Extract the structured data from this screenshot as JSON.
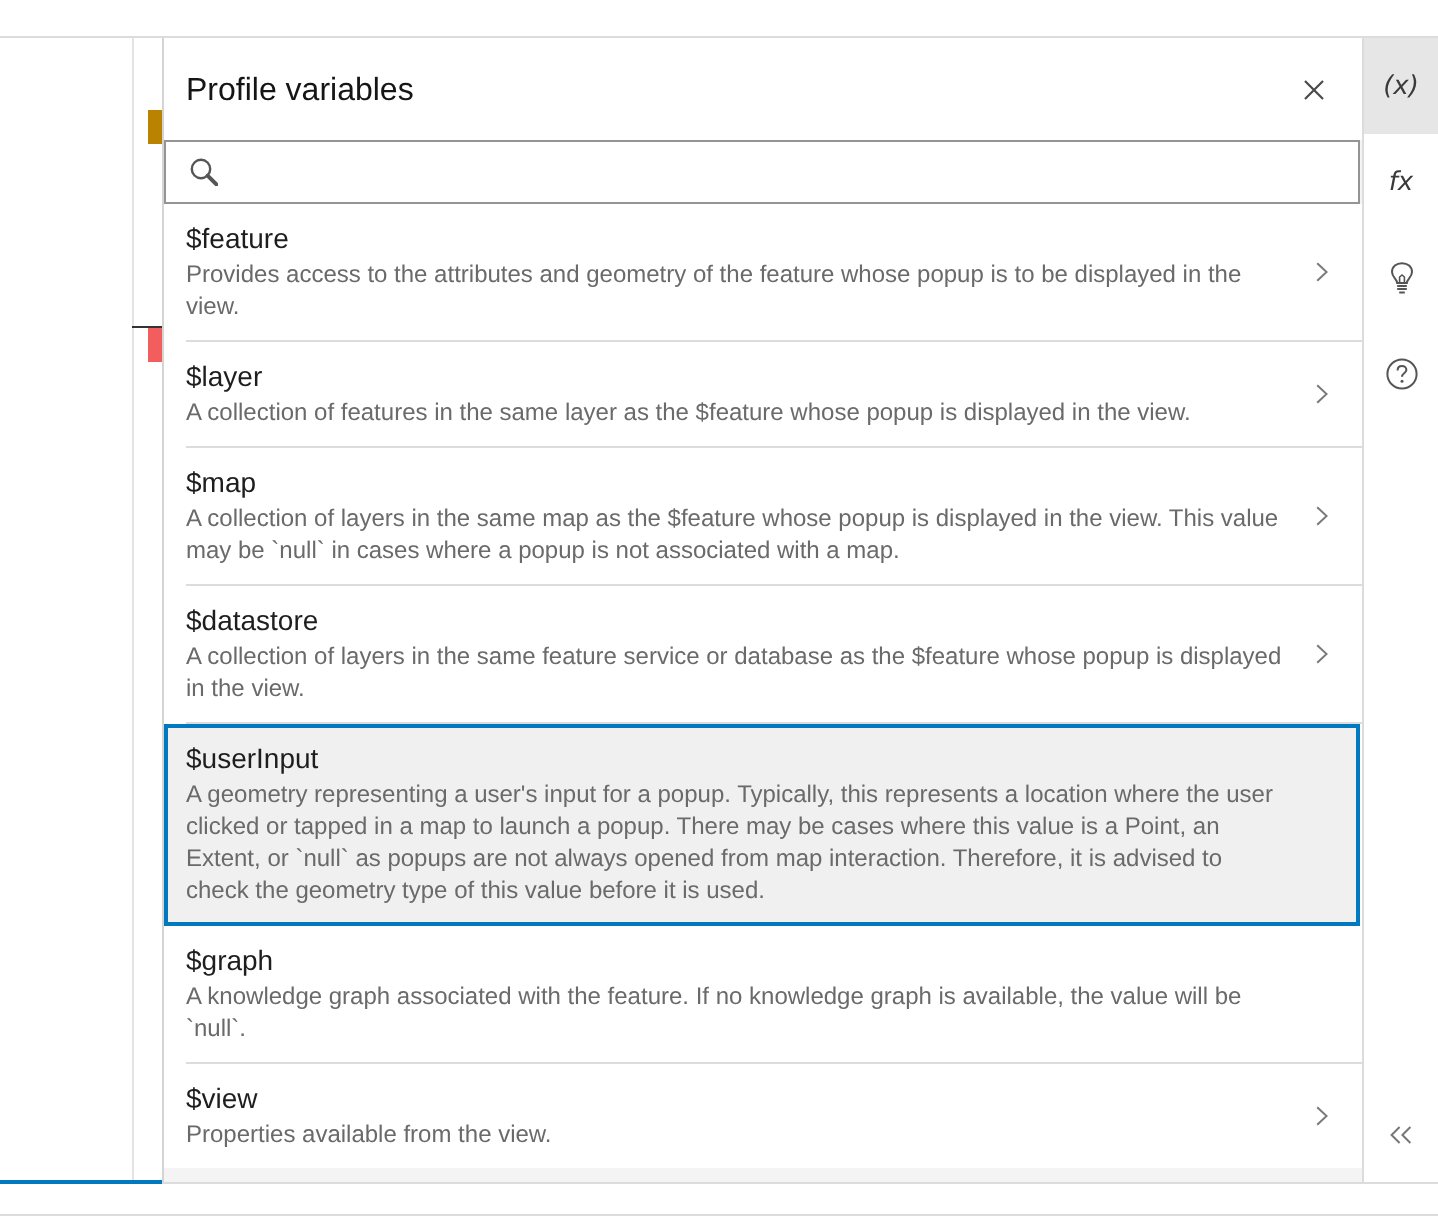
{
  "gutter_markers": [
    {
      "color": "#b98300"
    },
    {
      "color": "#f25d5d"
    }
  ],
  "panel": {
    "title": "Profile variables"
  },
  "variables": [
    {
      "name": "$feature",
      "description": "Provides access to the attributes and geometry of the feature whose popup is to be displayed in the view.",
      "selected": false,
      "has_details": true
    },
    {
      "name": "$layer",
      "description": "A collection of features in the same layer as the $feature whose popup is displayed in the view.",
      "selected": false,
      "has_details": true
    },
    {
      "name": "$map",
      "description": "A collection of layers in the same map as the $feature whose popup is displayed in the view. This value may be `null` in cases where a popup is not associated with a map.",
      "selected": false,
      "has_details": true
    },
    {
      "name": "$datastore",
      "description": "A collection of layers in the same feature service or database as the $feature whose popup is displayed in the view.",
      "selected": false,
      "has_details": true
    },
    {
      "name": "$userInput",
      "description": "A geometry representing a user's input for a popup. Typically, this represents a location where the user clicked or tapped in a map to launch a popup. There may be cases where this value is a Point, an Extent, or `null` as popups are not always opened from map interaction. Therefore, it is advised to check the geometry type of this value before it is used.",
      "selected": true,
      "has_details": false
    },
    {
      "name": "$graph",
      "description": "A knowledge graph associated with the feature. If no knowledge graph is available, the value will be `null`.",
      "selected": false,
      "has_details": false
    },
    {
      "name": "$view",
      "description": "Properties available from the view.",
      "selected": false,
      "has_details": true
    }
  ],
  "action_bar": {
    "actions": [
      {
        "kind": "text",
        "label": "(x)",
        "selected": true
      },
      {
        "kind": "text",
        "label": "fx",
        "selected": false
      },
      {
        "kind": "bulb",
        "selected": false
      },
      {
        "kind": "help",
        "selected": false
      }
    ]
  }
}
